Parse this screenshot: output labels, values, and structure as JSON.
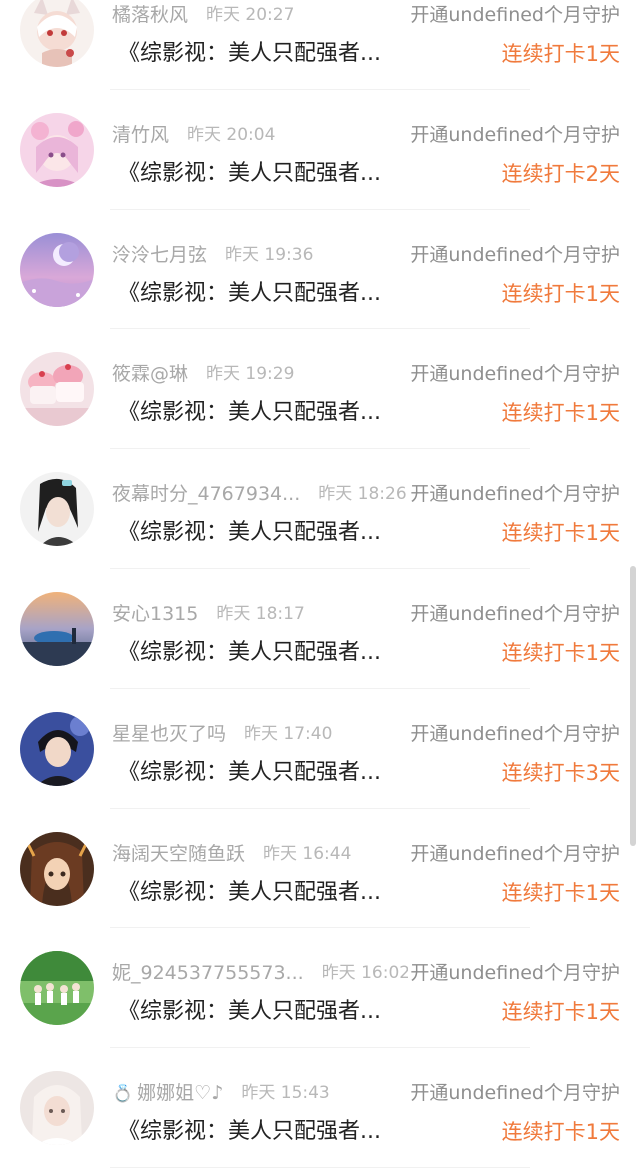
{
  "colors": {
    "name": "#a8a8a8",
    "time": "#b8b8b8",
    "action": "#8f8f8f",
    "book": "#222222",
    "streak": "#f07a3c"
  },
  "rows": [
    {
      "name": "橘落秋风",
      "time": "昨天 20:27",
      "action": "开通undefined个月守护",
      "book": "《综影视：美人只配强者...",
      "streak": "连续打卡1天"
    },
    {
      "name": "清竹风",
      "time": "昨天 20:04",
      "action": "开通undefined个月守护",
      "book": "《综影视：美人只配强者...",
      "streak": "连续打卡2天"
    },
    {
      "name": "泠泠七月弦",
      "time": "昨天 19:36",
      "action": "开通undefined个月守护",
      "book": "《综影视：美人只配强者...",
      "streak": "连续打卡1天"
    },
    {
      "name": "筱霖@琳",
      "time": "昨天 19:29",
      "action": "开通undefined个月守护",
      "book": "《综影视：美人只配强者...",
      "streak": "连续打卡1天"
    },
    {
      "name": "夜幕时分_4767934...",
      "time": "昨天 18:26",
      "action": "开通undefined个月守护",
      "book": "《综影视：美人只配强者...",
      "streak": "连续打卡1天"
    },
    {
      "name": "安心1315",
      "time": "昨天 18:17",
      "action": "开通undefined个月守护",
      "book": "《综影视：美人只配强者...",
      "streak": "连续打卡1天"
    },
    {
      "name": "星星也灭了吗",
      "time": "昨天 17:40",
      "action": "开通undefined个月守护",
      "book": "《综影视：美人只配强者...",
      "streak": "连续打卡3天"
    },
    {
      "name": "海阔天空随鱼跃",
      "time": "昨天 16:44",
      "action": "开通undefined个月守护",
      "book": "《综影视：美人只配强者...",
      "streak": "连续打卡1天"
    },
    {
      "name": "妮_924537755573...",
      "time": "昨天 16:02",
      "action": "开通undefined个月守护",
      "book": "《综影视：美人只配强者...",
      "streak": "连续打卡1天"
    },
    {
      "badge": "💍",
      "name": "娜娜姐♡♪",
      "time": "昨天 15:43",
      "action": "开通undefined个月守护",
      "book": "《综影视：美人只配强者...",
      "streak": "连续打卡1天"
    }
  ]
}
